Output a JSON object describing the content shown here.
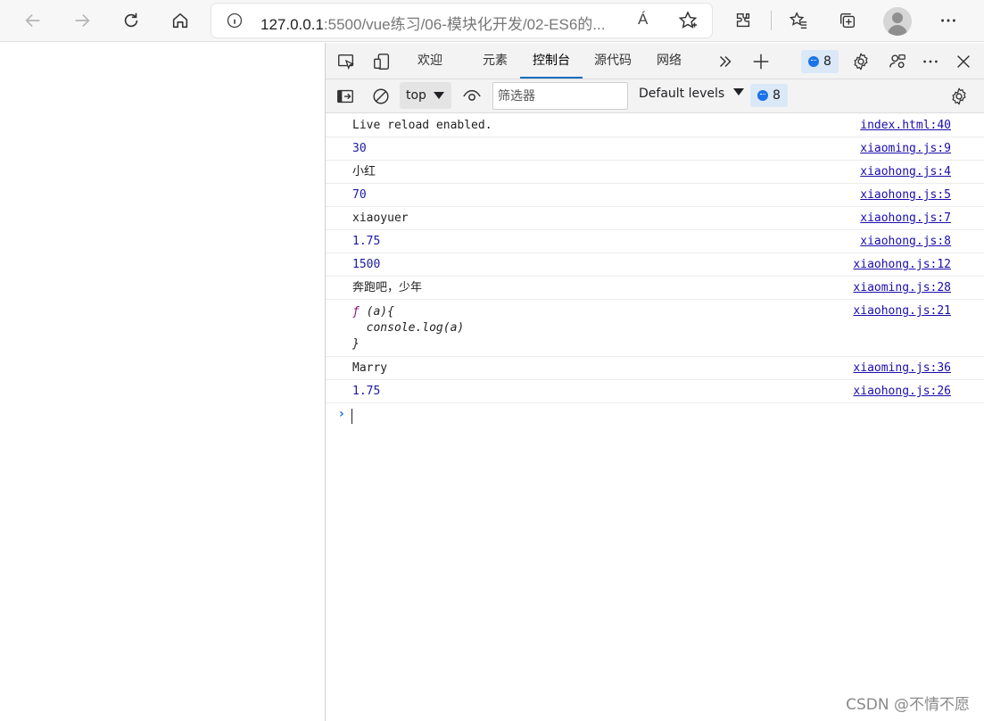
{
  "browser": {
    "address_host": "127.0.0.1",
    "address_rest": ":5500/vue练习/06-模块化开发/02-ES6的...",
    "read_aloud_glyph": "Á"
  },
  "devtools": {
    "tabs": [
      {
        "label": "欢迎"
      },
      {
        "label": "元素"
      },
      {
        "label": "控制台"
      },
      {
        "label": "源代码"
      },
      {
        "label": "网络"
      }
    ],
    "active_tab": "控制台",
    "issues_count": "8",
    "console_bar": {
      "context": "top",
      "filter_placeholder": "筛选器",
      "levels": "Default levels",
      "messages_count": "8"
    },
    "accent_color": "#0f6cbd"
  },
  "console": {
    "rows": [
      {
        "text": "Live reload enabled.",
        "source": "index.html:40"
      },
      {
        "text": "30",
        "source": "xiaoming.js:9"
      },
      {
        "text": "小红",
        "source": "xiaohong.js:4"
      },
      {
        "text": "70",
        "source": "xiaohong.js:5"
      },
      {
        "text": "xiaoyuer",
        "source": "xiaohong.js:7"
      },
      {
        "text": "1.75",
        "source": "xiaohong.js:8"
      },
      {
        "text": "1500",
        "source": "xiaohong.js:12"
      },
      {
        "text": "奔跑吧，少年",
        "source": "xiaoming.js:28"
      },
      {
        "fn_glyph": "ƒ",
        "fn_line1": " (a){",
        "fn_line2": "  console.log(a)",
        "fn_line3": "}",
        "source": "xiaohong.js:21"
      },
      {
        "text": "Marry",
        "source": "xiaoming.js:36"
      },
      {
        "text": "1.75",
        "source": "xiaohong.js:26"
      }
    ],
    "prompt_glyph": "›"
  },
  "watermark": "CSDN @不情不愿"
}
